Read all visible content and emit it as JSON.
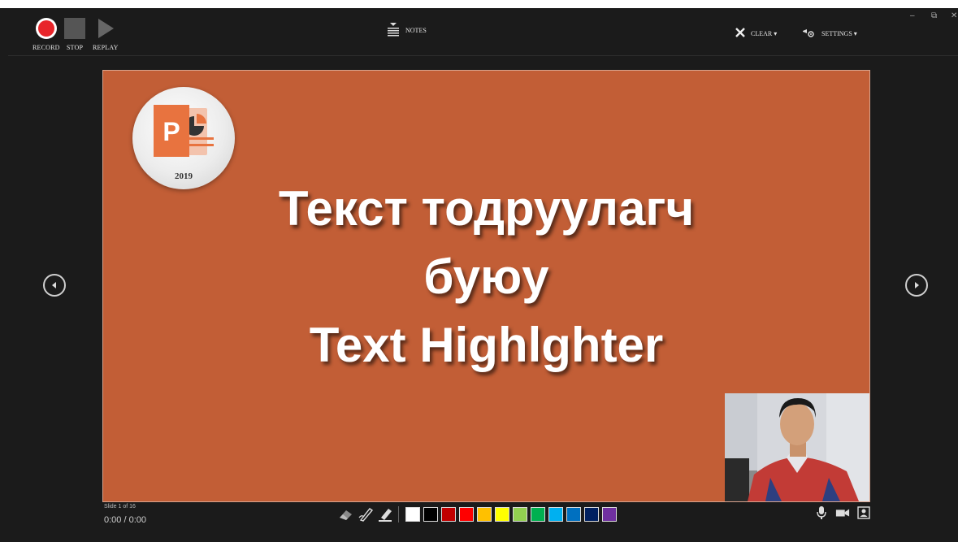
{
  "toolbar": {
    "record_label": "RECORD",
    "stop_label": "STOP",
    "replay_label": "REPLAY",
    "notes_label": "NOTES",
    "clear_label": "CLEAR ▾",
    "settings_label": "SETTINGS ▾",
    "minimize": "–",
    "restore": "⧉",
    "close": "✕"
  },
  "slide": {
    "logo_year": "2019",
    "title_line1": "Текст тодруулагч",
    "title_line2": "буюу",
    "title_line3": "Text Highlghter",
    "background_color": "#c25e36"
  },
  "footer": {
    "slide_counter": "Slide 1 of 16",
    "time": "0:00 / 0:00"
  },
  "ink_colors": [
    "#ffffff",
    "#000000",
    "#c00000",
    "#ff0000",
    "#ffc000",
    "#ffff00",
    "#92d050",
    "#00b050",
    "#00b0f0",
    "#0070c0",
    "#002060",
    "#7030a0"
  ],
  "icons": {
    "record": "record-icon",
    "stop": "stop-icon",
    "replay": "play-icon",
    "notes": "notes-icon",
    "clear": "x-icon",
    "settings": "settings-icon",
    "prev": "previous-slide-icon",
    "next": "next-slide-icon",
    "eraser": "eraser-icon",
    "pen": "pen-icon",
    "highlighter": "highlighter-icon",
    "mic": "microphone-icon",
    "camera": "camera-icon",
    "preview": "camera-preview-icon"
  }
}
